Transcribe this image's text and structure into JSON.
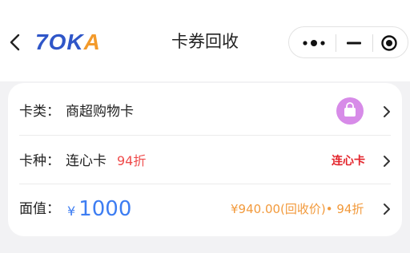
{
  "header": {
    "title": "卡券回收",
    "logo": {
      "part1": "7O",
      "part2": "K",
      "part3": "A"
    }
  },
  "form": {
    "card_type": {
      "label": "卡类：",
      "value": "商超购物卡"
    },
    "card_kind": {
      "label": "卡种：",
      "value": "连心卡",
      "discount": "94折",
      "brand_tag": "连心卡"
    },
    "face_value": {
      "label": "面值：",
      "currency": "¥",
      "amount": "1000",
      "recovery_text": "¥940.00(回收价)• 94折"
    }
  },
  "colors": {
    "accent_blue": "#3d7df2",
    "discount_red": "#ef4b4b",
    "brand_red": "#e3242b",
    "recovery_orange": "#f29a3c",
    "bag_purple": "#d78be8"
  }
}
